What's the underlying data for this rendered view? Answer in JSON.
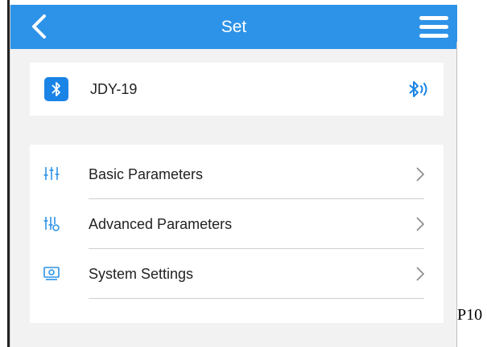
{
  "header": {
    "title": "Set",
    "back_icon": "back-arrow-icon",
    "menu_icon": "hamburger-menu-icon",
    "background_color": "#2d93e8"
  },
  "device": {
    "name": "JDY-19",
    "icon": "bluetooth-icon",
    "status_icon": "bluetooth-signal-icon",
    "accent_color": "#1a84e6"
  },
  "settings": {
    "items": [
      {
        "label": "Basic Parameters",
        "icon": "sliders-icon"
      },
      {
        "label": "Advanced Parameters",
        "icon": "advanced-sliders-icon"
      },
      {
        "label": "System Settings",
        "icon": "monitor-icon"
      }
    ],
    "chevron_icon": "chevron-right-icon"
  },
  "page_label": "P10"
}
